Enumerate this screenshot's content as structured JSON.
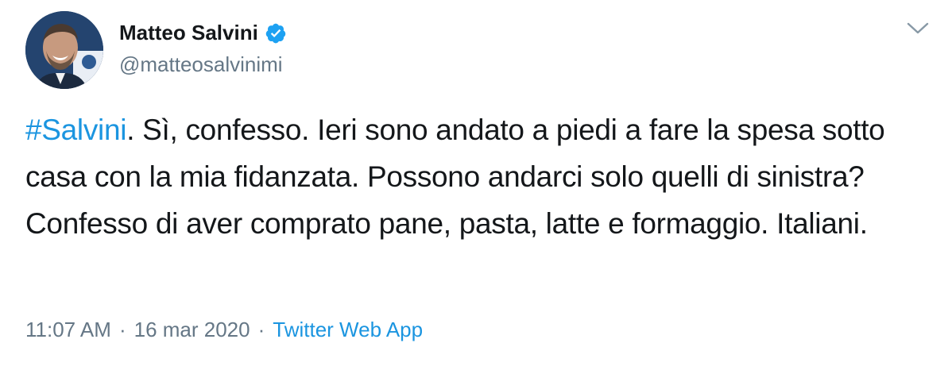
{
  "tweet": {
    "author": {
      "name": "Matteo Salvini",
      "handle": "@matteosalvinimi",
      "verified_icon": "verified-badge-icon",
      "verified_color": "#1da1f2"
    },
    "menu_icon": "chevron-down-icon",
    "text": {
      "hashtag": "#Salvini",
      "body": ". Sì, confesso. Ieri sono andato a piedi a fare la spesa sotto casa con la mia fidanzata. Possono andarci solo quelli di sinistra? Confesso di aver comprato pane, pasta, latte e formaggio. Italiani."
    },
    "meta": {
      "time": "11:07 AM",
      "separator": "·",
      "date": "16 mar 2020",
      "source": "Twitter Web App"
    },
    "colors": {
      "link": "#1b95e0",
      "secondary": "#657786",
      "primary_text": "#14171a"
    }
  }
}
